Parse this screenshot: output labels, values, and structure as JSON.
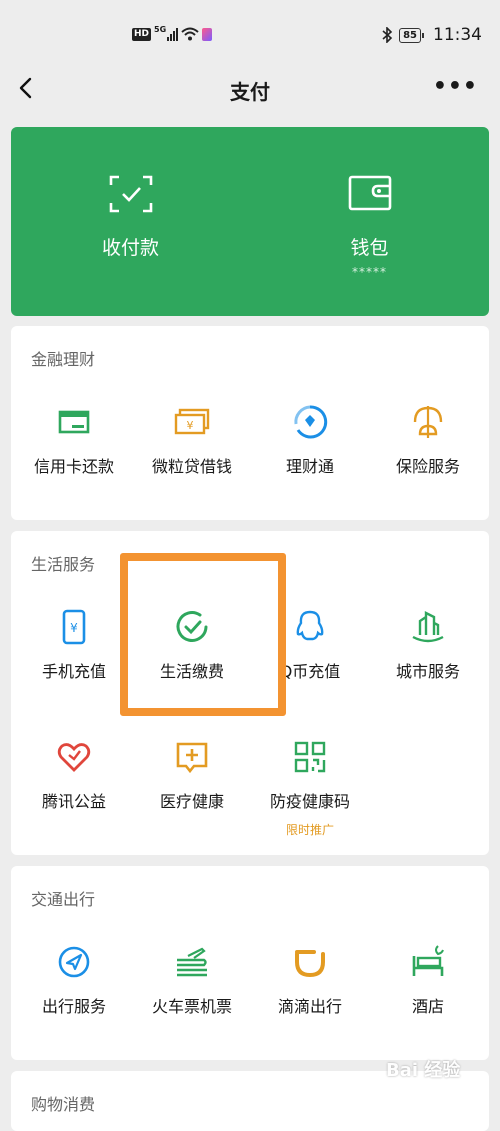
{
  "status_bar": {
    "hd": "HD",
    "network": "5G",
    "battery": "85",
    "time": "11:34"
  },
  "nav": {
    "title": "支付",
    "more": "•••"
  },
  "wallet_card": {
    "receive_pay_label": "收付款",
    "wallet_label": "钱包",
    "wallet_balance_masked": "*****"
  },
  "sections": {
    "finance": {
      "title": "金融理财",
      "items": [
        {
          "label": "信用卡还款",
          "icon": "credit-card-icon"
        },
        {
          "label": "微粒贷借钱",
          "icon": "loan-cash-icon"
        },
        {
          "label": "理财通",
          "icon": "wealth-icon"
        },
        {
          "label": "保险服务",
          "icon": "insurance-umbrella-icon"
        }
      ]
    },
    "life": {
      "title": "生活服务",
      "items": [
        {
          "label": "手机充值",
          "icon": "phone-topup-icon"
        },
        {
          "label": "生活缴费",
          "icon": "utility-bill-icon"
        },
        {
          "label": "Q币充值",
          "icon": "qq-penguin-icon"
        },
        {
          "label": "城市服务",
          "icon": "city-building-icon"
        },
        {
          "label": "腾讯公益",
          "icon": "charity-heart-icon"
        },
        {
          "label": "医疗健康",
          "icon": "medical-plus-icon"
        },
        {
          "label": "防疫健康码",
          "icon": "health-qr-code-icon",
          "promo": "限时推广"
        }
      ]
    },
    "transport": {
      "title": "交通出行",
      "items": [
        {
          "label": "出行服务",
          "icon": "navigation-icon"
        },
        {
          "label": "火车票机票",
          "icon": "train-plane-icon"
        },
        {
          "label": "滴滴出行",
          "icon": "didi-icon"
        },
        {
          "label": "酒店",
          "icon": "hotel-bed-icon"
        }
      ]
    },
    "shopping": {
      "title": "购物消费"
    }
  },
  "watermark": "Bai 经验",
  "colors": {
    "green": "#2fa75d",
    "icon_green": "#2fa75d",
    "icon_orange": "#e39b22",
    "icon_blue": "#1b8fe6",
    "icon_red": "#e0463c",
    "highlight": "#f39331"
  }
}
